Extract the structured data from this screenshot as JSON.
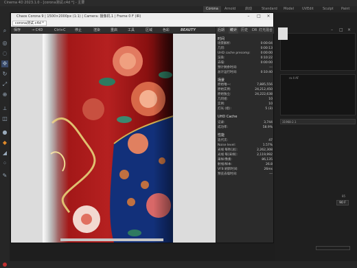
{
  "c4d": {
    "title": "Cinema 4D 2023.1.0 - [corona测试.c4d *] - 主要",
    "layout_tabs": [
      {
        "label": "Corona",
        "active": true
      },
      {
        "label": "Arnold",
        "active": false
      },
      {
        "label": "启动",
        "active": false
      },
      {
        "label": "Standard",
        "active": false
      },
      {
        "label": "Model",
        "active": false
      },
      {
        "label": "UVEdit",
        "active": false
      },
      {
        "label": "Sculpt",
        "active": false
      },
      {
        "label": "Paint",
        "active": false
      }
    ],
    "right_value": "90 F",
    "right_small": "85",
    "right_text_1": "ra 4 AF",
    "right_text_2": "31968-2.1"
  },
  "vfb": {
    "title": "Chaos Corona 9 | 1500×2000px (1:1) | Camera: 摄像机.1 | Frame 0 F (IR)",
    "tab_label": "corona测试.c4d *",
    "toolbar": {
      "save": "保存",
      "c4d": "→ C4D",
      "ctrl": "Ctrl+C",
      "stop": "停止",
      "render": "渲染",
      "restart": "重启",
      "tools": "工具",
      "region": "区域",
      "color": "色彩",
      "beauty": "BEAUTY"
    },
    "stats_tabs": [
      "后期",
      "统计",
      "历史",
      "DR",
      "灯光混合"
    ],
    "sections": {
      "time": "时间",
      "scene": "场景",
      "uhd": "UHD Cache",
      "perf": "性能"
    },
    "time_rows": [
      {
        "label": "场景解析:",
        "value": "0:00:04"
      },
      {
        "label": "几何:",
        "value": "0:00:13"
      },
      {
        "label": "UHD cache precomp:",
        "value": "0:00:00"
      },
      {
        "label": "渲染:",
        "value": "0:10:22"
      },
      {
        "label": "去噪:",
        "value": "0:00:00"
      },
      {
        "label": "预计剩余时间:",
        "value": "---"
      },
      {
        "label": "总计运行时间:",
        "value": "0:10:40"
      }
    ],
    "scene_rows": [
      {
        "label": "原始唯一:",
        "value": "7,885,556"
      },
      {
        "label": "原始实例:",
        "value": "24,212,450"
      },
      {
        "label": "原始独立:",
        "value": "24,222,638"
      },
      {
        "label": "几何组:",
        "value": "10"
      },
      {
        "label": "实例:",
        "value": "10"
      },
      {
        "label": "灯光 (组):",
        "value": "5 (3)"
      }
    ],
    "uhd_rows": [
      {
        "label": "记录:",
        "value": "3,744"
      },
      {
        "label": "成功率:",
        "value": "58.9%"
      }
    ],
    "perf_rows": [
      {
        "label": "迭代次:",
        "value": "47"
      },
      {
        "label": "Noise level:",
        "value": "1.57%"
      },
      {
        "label": "光线 每秒[总]:",
        "value": "2,262,308"
      },
      {
        "label": "光线 每[采样]:",
        "value": "2,119,992"
      },
      {
        "label": "采样/像素:",
        "value": "86,135"
      },
      {
        "label": "射线/样本:",
        "value": "26.8"
      },
      {
        "label": "VFB 刷新时间:",
        "value": "26ms"
      },
      {
        "label": "预览去噪时间:",
        "value": "---"
      }
    ]
  }
}
